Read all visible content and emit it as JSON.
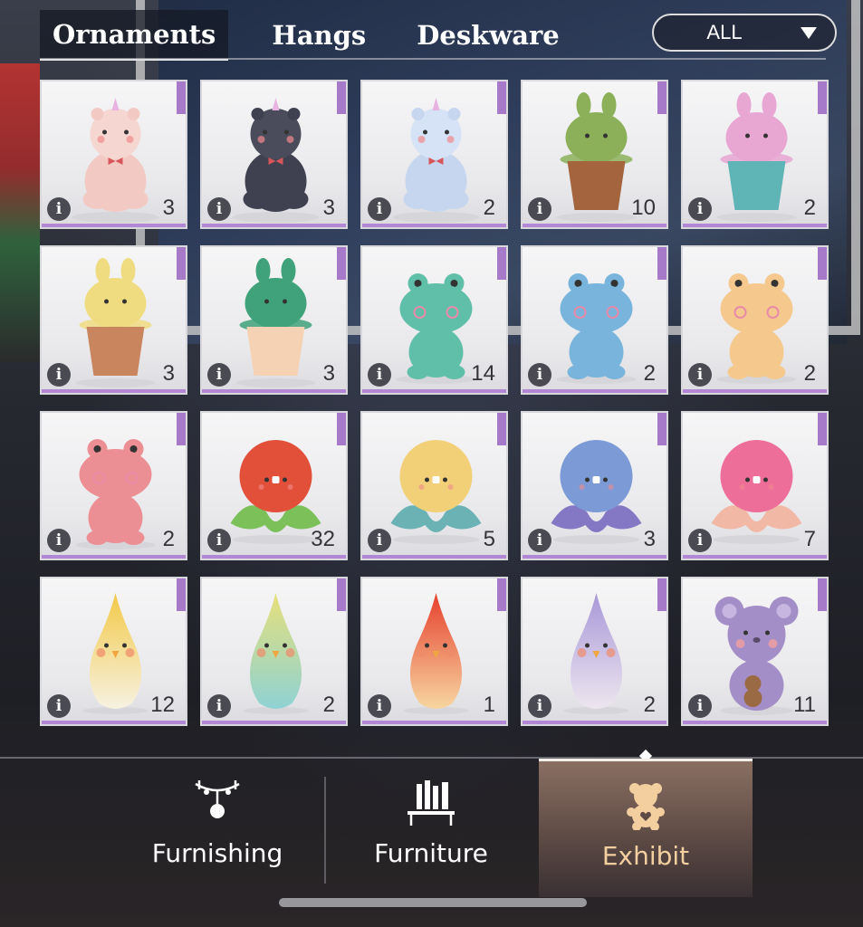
{
  "top_tabs": [
    "Ornaments",
    "Hangs",
    "Deskware"
  ],
  "active_top_tab": 0,
  "filter": {
    "selected": "ALL"
  },
  "items": [
    {
      "name": "pink-unicorn-bear",
      "count": "3"
    },
    {
      "name": "black-cat-bear",
      "count": "3"
    },
    {
      "name": "blue-unicorn-bear",
      "count": "2"
    },
    {
      "name": "green-bunny-pot",
      "count": "10"
    },
    {
      "name": "pink-bunny-cup",
      "count": "2"
    },
    {
      "name": "yellow-bunny-pot",
      "count": "3"
    },
    {
      "name": "green-bunny-cup",
      "count": "3"
    },
    {
      "name": "teal-frog",
      "count": "14"
    },
    {
      "name": "blue-frog",
      "count": "2"
    },
    {
      "name": "orange-frog",
      "count": "2"
    },
    {
      "name": "pink-frog",
      "count": "2"
    },
    {
      "name": "red-green-octopus",
      "count": "32"
    },
    {
      "name": "yellow-teal-octopus",
      "count": "5"
    },
    {
      "name": "blue-purple-octopus",
      "count": "3"
    },
    {
      "name": "pink-peach-octopus",
      "count": "7"
    },
    {
      "name": "yellow-bird",
      "count": "12"
    },
    {
      "name": "mint-bird",
      "count": "2"
    },
    {
      "name": "red-bird",
      "count": "1"
    },
    {
      "name": "lavender-bird",
      "count": "2"
    },
    {
      "name": "purple-koala",
      "count": "11"
    }
  ],
  "bottom_nav": [
    {
      "label": "Furnishing",
      "icon": "chandelier-icon"
    },
    {
      "label": "Furniture",
      "icon": "bookshelf-icon"
    },
    {
      "label": "Exhibit",
      "icon": "teddy-bear-icon"
    }
  ],
  "active_bottom_tab": 2,
  "colors": {
    "rarity_purple": "#a67ac8",
    "active_tab_text": "#f3cfa0"
  }
}
